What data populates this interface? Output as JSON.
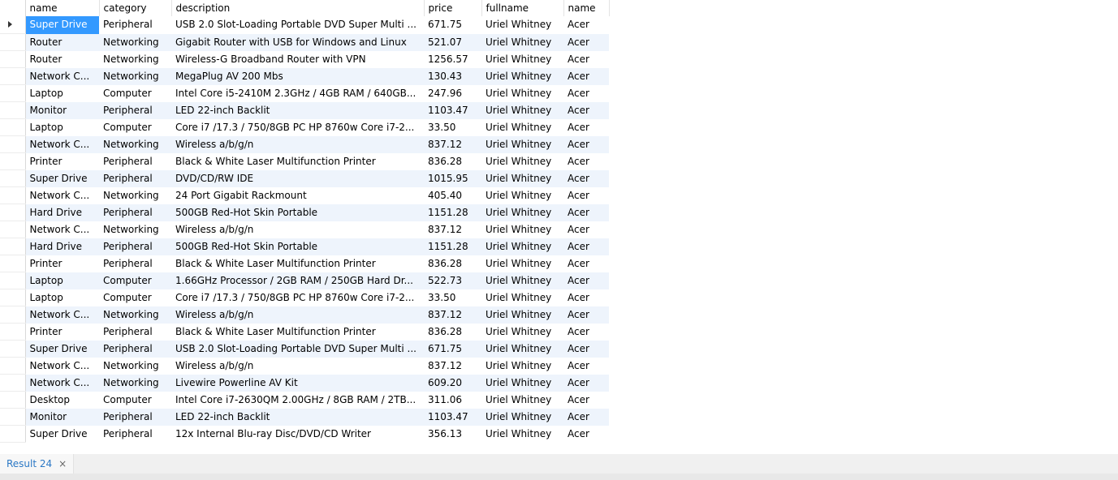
{
  "columns": [
    "name",
    "category",
    "description",
    "price",
    "fullname",
    "name"
  ],
  "rows": [
    [
      "Super Drive",
      "Peripheral",
      "USB 2.0 Slot-Loading Portable DVD Super Multi ...",
      "671.75",
      "Uriel Whitney",
      "Acer"
    ],
    [
      "Router",
      "Networking",
      "Gigabit Router with USB for Windows and Linux",
      "521.07",
      "Uriel Whitney",
      "Acer"
    ],
    [
      "Router",
      "Networking",
      "Wireless-G Broadband Router with VPN",
      "1256.57",
      "Uriel Whitney",
      "Acer"
    ],
    [
      "Network C...",
      "Networking",
      "MegaPlug AV 200 Mbs",
      "130.43",
      "Uriel Whitney",
      "Acer"
    ],
    [
      "Laptop",
      "Computer",
      "Intel Core i5-2410M 2.3GHz / 4GB RAM / 640GB...",
      "247.96",
      "Uriel Whitney",
      "Acer"
    ],
    [
      "Monitor",
      "Peripheral",
      "LED 22-inch Backlit",
      "1103.47",
      "Uriel Whitney",
      "Acer"
    ],
    [
      "Laptop",
      "Computer",
      "Core i7 /17.3 / 750/8GB PC HP 8760w Core i7-2...",
      "33.50",
      "Uriel Whitney",
      "Acer"
    ],
    [
      "Network C...",
      "Networking",
      "Wireless a/b/g/n",
      "837.12",
      "Uriel Whitney",
      "Acer"
    ],
    [
      "Printer",
      "Peripheral",
      "Black & White Laser Multifunction Printer",
      "836.28",
      "Uriel Whitney",
      "Acer"
    ],
    [
      "Super Drive",
      "Peripheral",
      "DVD/CD/RW IDE",
      "1015.95",
      "Uriel Whitney",
      "Acer"
    ],
    [
      "Network C...",
      "Networking",
      "24 Port Gigabit Rackmount",
      "405.40",
      "Uriel Whitney",
      "Acer"
    ],
    [
      "Hard Drive",
      "Peripheral",
      "500GB Red-Hot Skin Portable",
      "1151.28",
      "Uriel Whitney",
      "Acer"
    ],
    [
      "Network C...",
      "Networking",
      "Wireless a/b/g/n",
      "837.12",
      "Uriel Whitney",
      "Acer"
    ],
    [
      "Hard Drive",
      "Peripheral",
      "500GB Red-Hot Skin Portable",
      "1151.28",
      "Uriel Whitney",
      "Acer"
    ],
    [
      "Printer",
      "Peripheral",
      "Black & White Laser Multifunction Printer",
      "836.28",
      "Uriel Whitney",
      "Acer"
    ],
    [
      "Laptop",
      "Computer",
      " 1.66GHz Processor / 2GB RAM / 250GB Hard Dr...",
      "522.73",
      "Uriel Whitney",
      "Acer"
    ],
    [
      "Laptop",
      "Computer",
      "Core i7 /17.3 / 750/8GB PC HP 8760w Core i7-2...",
      "33.50",
      "Uriel Whitney",
      "Acer"
    ],
    [
      "Network C...",
      "Networking",
      "Wireless a/b/g/n",
      "837.12",
      "Uriel Whitney",
      "Acer"
    ],
    [
      "Printer",
      "Peripheral",
      "Black & White Laser Multifunction Printer",
      "836.28",
      "Uriel Whitney",
      "Acer"
    ],
    [
      "Super Drive",
      "Peripheral",
      "USB 2.0 Slot-Loading Portable DVD Super Multi ...",
      "671.75",
      "Uriel Whitney",
      "Acer"
    ],
    [
      "Network C...",
      "Networking",
      "Wireless a/b/g/n",
      "837.12",
      "Uriel Whitney",
      "Acer"
    ],
    [
      "Network C...",
      "Networking",
      "Livewire Powerline AV Kit",
      "609.20",
      "Uriel Whitney",
      "Acer"
    ],
    [
      "Desktop",
      "Computer",
      "Intel Core i7-2630QM 2.00GHz / 8GB RAM / 2TB...",
      "311.06",
      "Uriel Whitney",
      "Acer"
    ],
    [
      "Monitor",
      "Peripheral",
      "LED 22-inch Backlit",
      "1103.47",
      "Uriel Whitney",
      "Acer"
    ],
    [
      "Super Drive",
      "Peripheral",
      "12x Internal Blu-ray Disc/DVD/CD Writer",
      "356.13",
      "Uriel Whitney",
      "Acer"
    ]
  ],
  "selected_row": 0,
  "result_tab": {
    "label": "Result 24",
    "close": "×"
  },
  "colors": {
    "selection": "#3399ff",
    "alt_row": "#eef4fc",
    "tab_text": "#2b78c5"
  }
}
